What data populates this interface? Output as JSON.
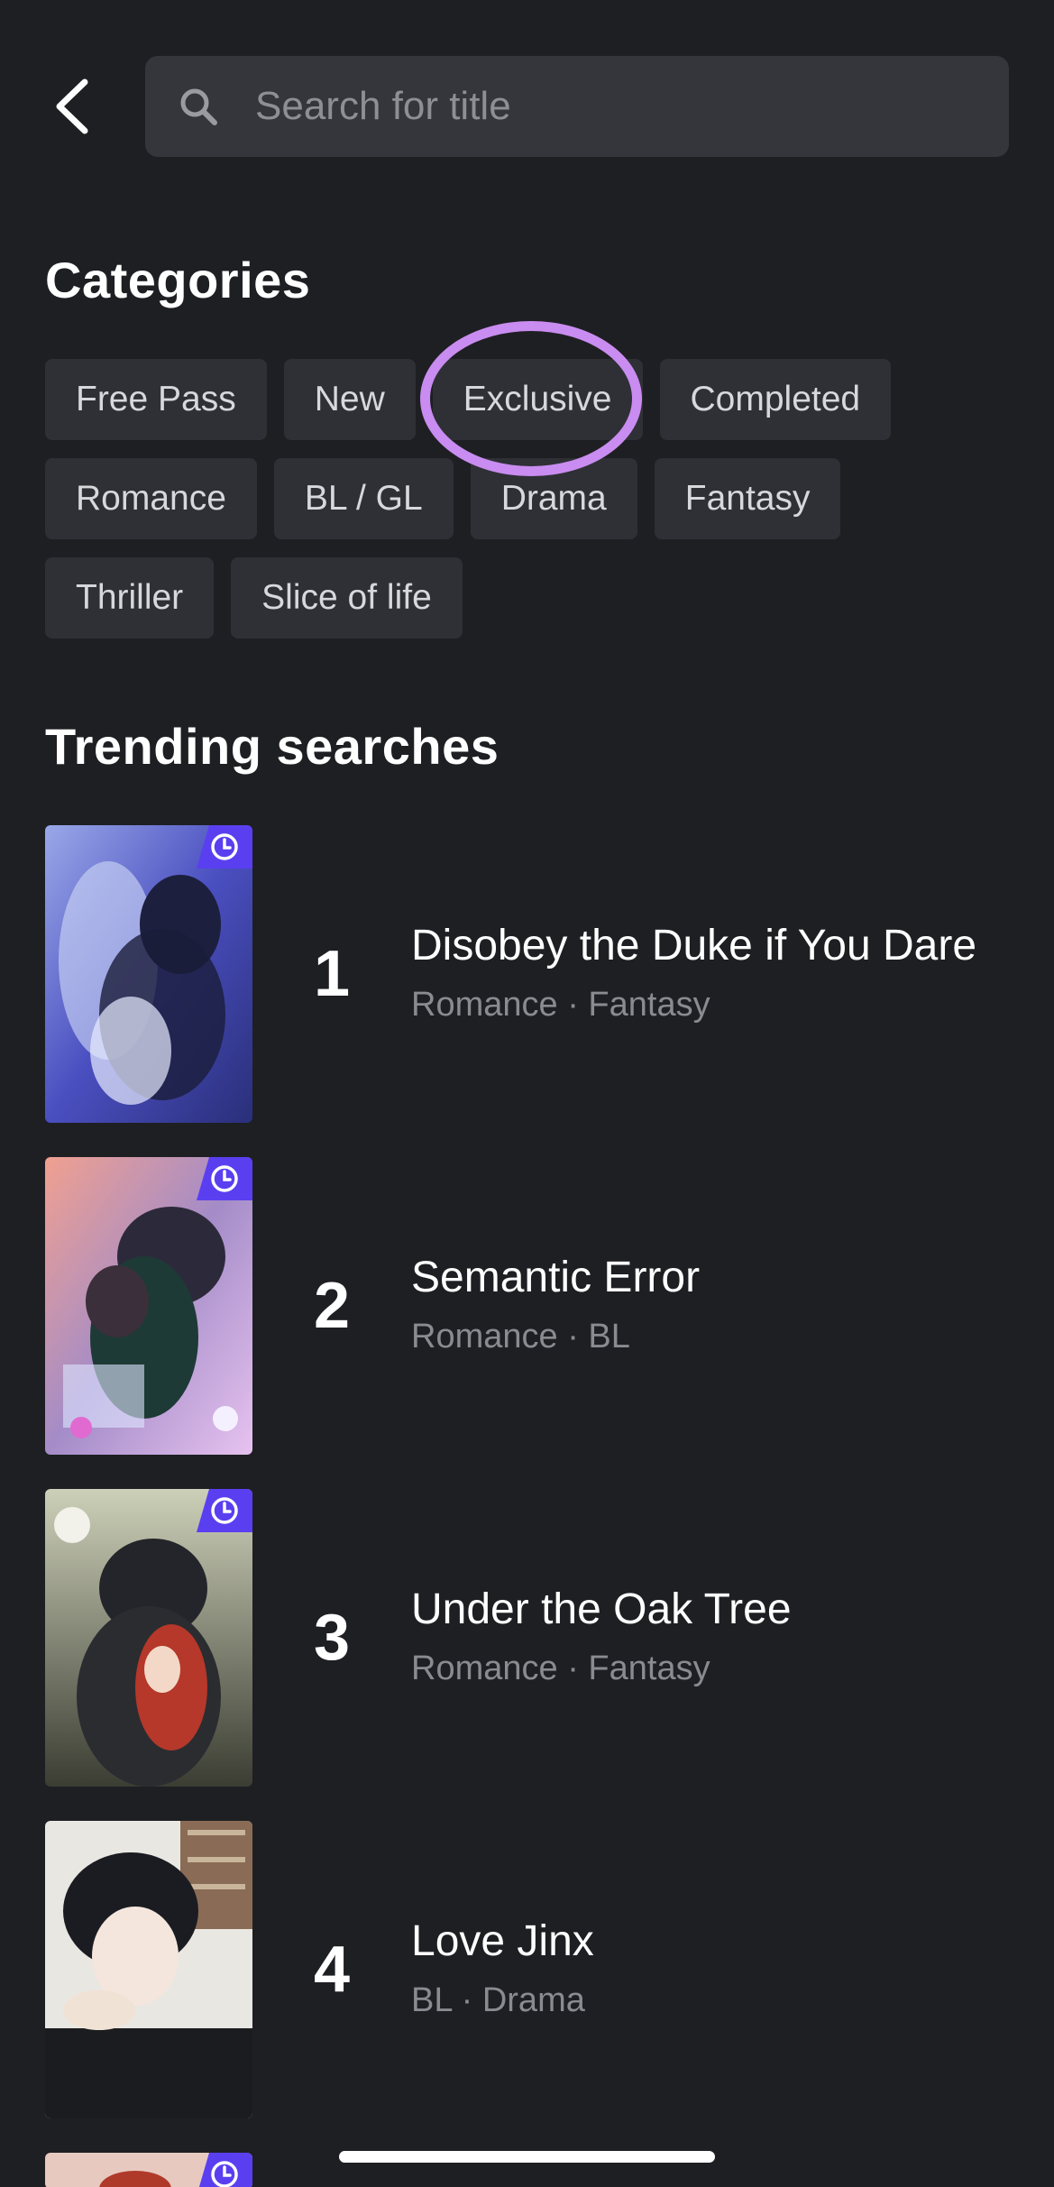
{
  "header": {
    "back_icon": "chevron-left-icon",
    "search_icon": "search-icon",
    "search_placeholder": "Search for title",
    "search_value": ""
  },
  "categories": {
    "title": "Categories",
    "rows": [
      [
        "Free Pass",
        "New",
        "Exclusive",
        "Completed"
      ],
      [
        "Romance",
        "BL / GL",
        "Drama",
        "Fantasy"
      ],
      [
        "Thriller",
        "Slice of life"
      ]
    ],
    "highlighted": "Exclusive",
    "highlight_color": "#c98cf0"
  },
  "trending": {
    "title": "Trending searches",
    "items": [
      {
        "rank": "1",
        "title": "Disobey the Duke if You Dare",
        "genres": "Romance · Fantasy",
        "badge": "clock-icon",
        "badge_color": "#5a3ff0"
      },
      {
        "rank": "2",
        "title": "Semantic Error",
        "genres": "Romance · BL",
        "badge": "clock-icon",
        "badge_color": "#5a3ff0"
      },
      {
        "rank": "3",
        "title": "Under the Oak Tree",
        "genres": "Romance · Fantasy",
        "badge": "clock-icon",
        "badge_color": "#5a3ff0"
      },
      {
        "rank": "4",
        "title": "Love Jinx",
        "genres": "BL · Drama",
        "badge": "",
        "badge_color": ""
      }
    ]
  },
  "colors": {
    "background": "#1e1f23",
    "chip_bg": "#2f3035",
    "search_bg": "#35363b",
    "secondary_text": "#8a8b90"
  }
}
